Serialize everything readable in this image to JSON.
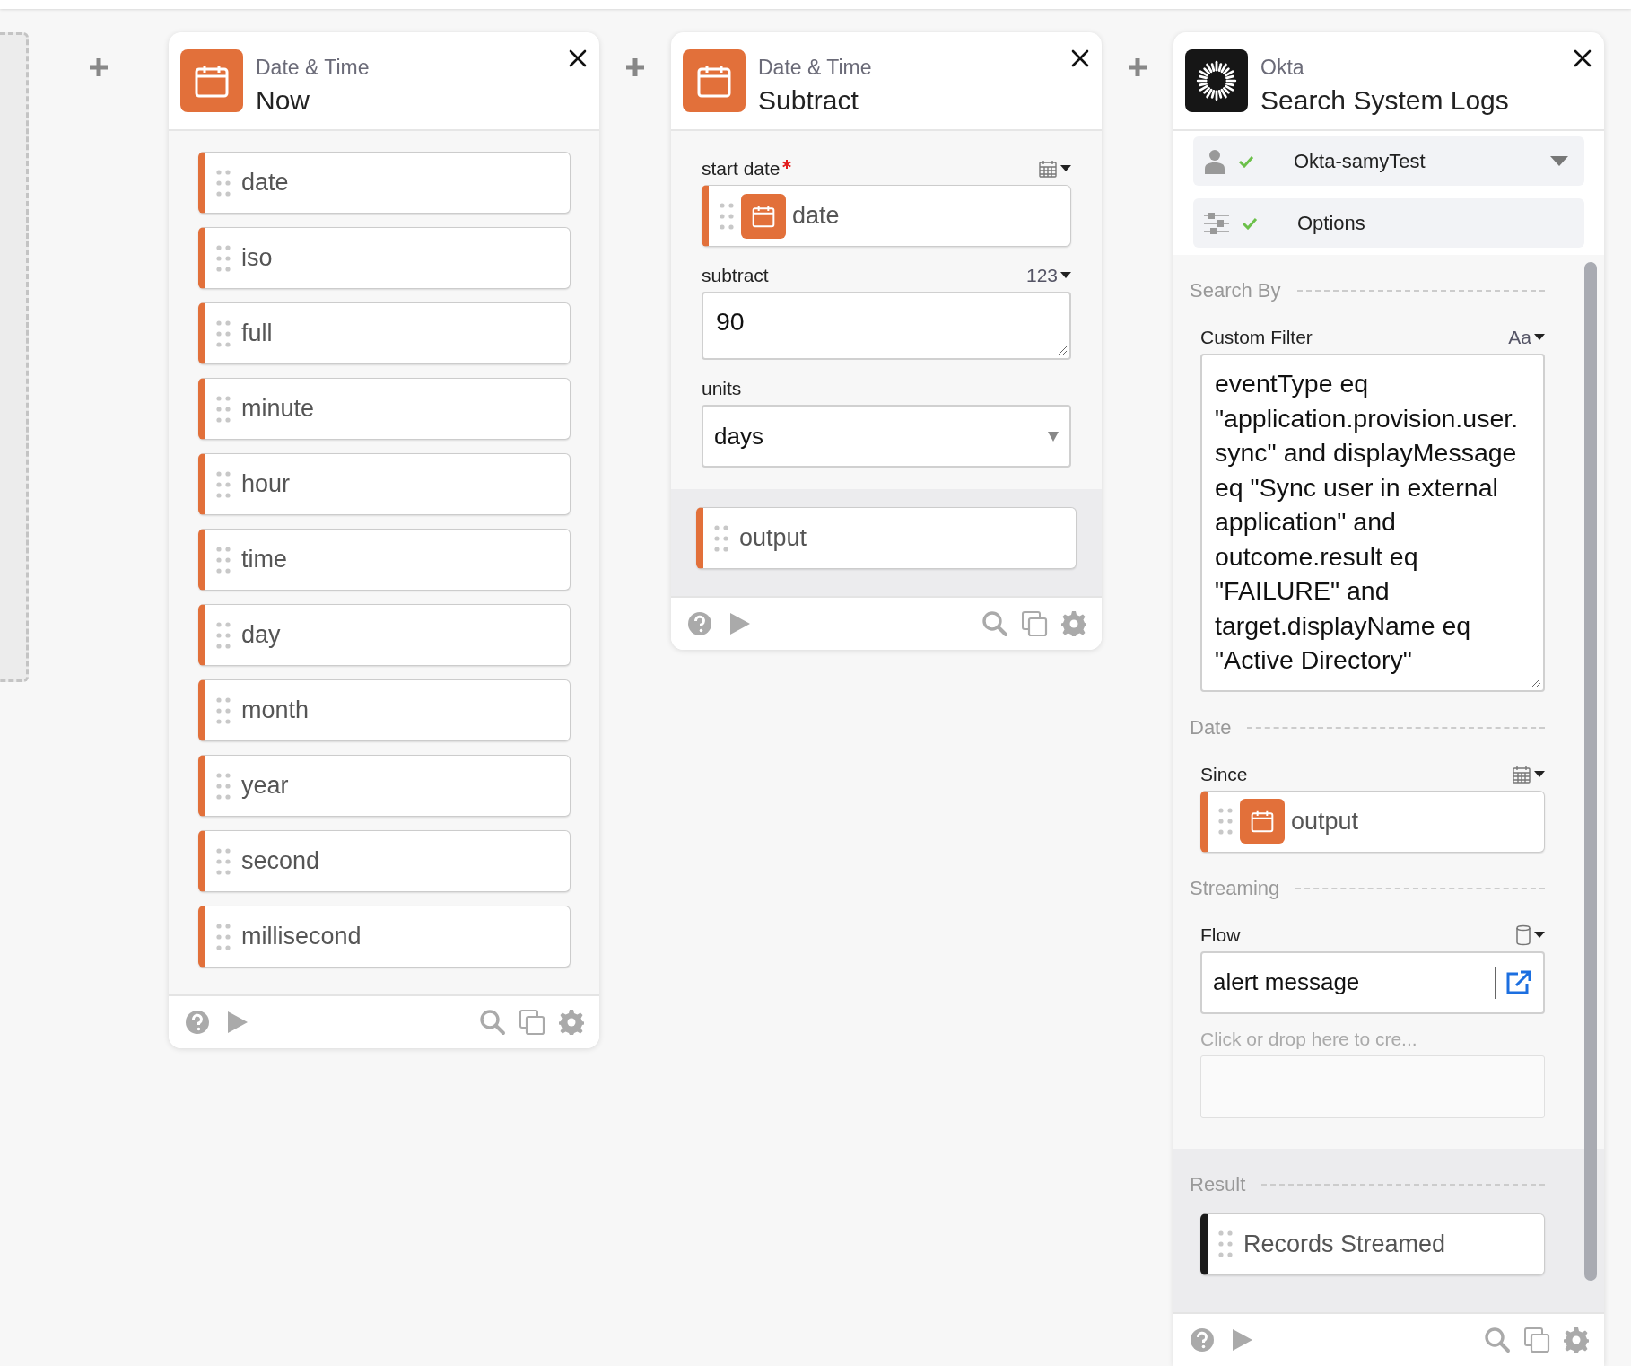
{
  "cards": [
    {
      "kind": "datetime",
      "app": "Date & Time",
      "title": "Now",
      "outputs": [
        {
          "label": "date",
          "color": "#e2703a"
        },
        {
          "label": "iso",
          "color": "#e2703a"
        },
        {
          "label": "full",
          "color": "#e2703a"
        },
        {
          "label": "minute",
          "color": "#e2703a"
        },
        {
          "label": "hour",
          "color": "#e2703a"
        },
        {
          "label": "time",
          "color": "#e2703a"
        },
        {
          "label": "day",
          "color": "#e2703a"
        },
        {
          "label": "month",
          "color": "#e2703a"
        },
        {
          "label": "year",
          "color": "#e2703a"
        },
        {
          "label": "second",
          "color": "#e2703a"
        },
        {
          "label": "millisecond",
          "color": "#e2703a"
        }
      ]
    },
    {
      "kind": "datetime",
      "app": "Date & Time",
      "title": "Subtract",
      "sections": [
        {
          "fields": [
            {
              "kind": "pill",
              "label": "start date",
              "required": true,
              "picker": {
                "kind": "date"
              },
              "value": "date",
              "color": "#e2703a"
            },
            {
              "kind": "textarea",
              "label": "subtract",
              "required": false,
              "picker": {
                "kind": "number",
                "text": "123"
              },
              "value": "90"
            },
            {
              "kind": "select",
              "label": "units",
              "required": false,
              "value": "days"
            }
          ]
        }
      ],
      "outputs": [
        {
          "label": "output",
          "color": "#e2703a"
        }
      ]
    },
    {
      "kind": "okta",
      "app": "Okta",
      "title": "Search System Logs",
      "connection": {
        "name": "Okta-samyTest",
        "valid": true
      },
      "options": {
        "label": "Options",
        "valid": true
      },
      "sections": [
        {
          "title": "Search By",
          "fields": [
            {
              "kind": "textarea",
              "label": "Custom Filter",
              "required": false,
              "picker": {
                "kind": "text",
                "text": "Aa"
              },
              "value": "eventType eq \"application.provision.user.sync\" and displayMessage eq \"Sync user in external application\" and outcome.result eq \"FAILURE\" and target.displayName eq \"Active Directory\""
            }
          ]
        },
        {
          "title": "Date",
          "fields": [
            {
              "kind": "pill",
              "label": "Since",
              "required": false,
              "picker": {
                "kind": "date"
              },
              "value": "output",
              "color": "#e2703a"
            }
          ]
        },
        {
          "title": "Streaming",
          "fields": [
            {
              "kind": "flow",
              "label": "Flow",
              "required": false,
              "picker": {
                "kind": "flow"
              },
              "value": "alert message"
            },
            {
              "kind": "dropzone",
              "placeholder": "Click or drop here to cre..."
            }
          ]
        }
      ],
      "outputs_title": "Result",
      "outputs": [
        {
          "label": "Records Streamed",
          "color": "#1a1a1a"
        }
      ]
    }
  ]
}
